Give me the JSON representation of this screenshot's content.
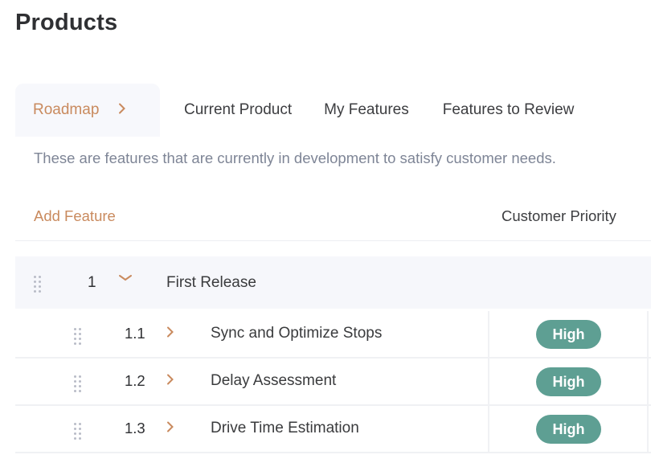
{
  "page": {
    "title": "Products"
  },
  "tabs": [
    {
      "label": "Roadmap",
      "active": true,
      "icon": "chevron-right-icon"
    },
    {
      "label": "Current Product",
      "active": false
    },
    {
      "label": "My Features",
      "active": false
    },
    {
      "label": "Features to Review",
      "active": false
    }
  ],
  "description": "These are features that are currently in development to satisfy customer needs.",
  "toolbar": {
    "add_feature_label": "Add Feature"
  },
  "columns": {
    "priority_header": "Customer Priority"
  },
  "group": {
    "number": "1",
    "name": "First Release",
    "expanded": true,
    "icon": "chevron-down-icon"
  },
  "features": [
    {
      "number": "1.1",
      "name": "Sync and Optimize Stops",
      "priority": "High"
    },
    {
      "number": "1.2",
      "name": "Delay Assessment",
      "priority": "High"
    },
    {
      "number": "1.3",
      "name": "Drive Time Estimation",
      "priority": "High"
    }
  ],
  "colors": {
    "accent": "#c98a5e",
    "priority_high": "#5e9f93",
    "description_text": "#7e8596",
    "row_highlight": "#f6f7fb"
  },
  "icons": {
    "chevron_right": "›",
    "chevron_down": "⌄"
  }
}
